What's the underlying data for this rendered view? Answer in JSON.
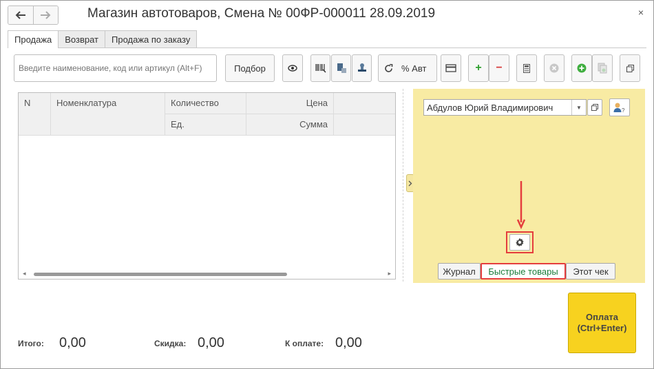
{
  "window": {
    "title": "Магазин автотоваров, Смена № 00ФР-000011  28.09.2019",
    "close_glyph": "×",
    "back_glyph": "🡐",
    "forward_glyph": "🡒"
  },
  "tabs": [
    {
      "label": "Продажа",
      "active": true
    },
    {
      "label": "Возврат",
      "active": false
    },
    {
      "label": "Продажа по заказу",
      "active": false
    }
  ],
  "toolbar": {
    "search_placeholder": "Введите наименование, код или артикул (Alt+F)",
    "podbor_label": "Подбор",
    "auto_discount_label": "% Авт",
    "plus_glyph": "+",
    "minus_glyph": "−"
  },
  "grid": {
    "columns": {
      "n": "N",
      "nomenclature": "Номенклатура",
      "quantity": "Количество",
      "price": "Цена",
      "unit": "Ед.",
      "sum": "Сумма"
    },
    "rows": []
  },
  "panel": {
    "cashier_name": "Абдулов Юрий Владимирович",
    "tabs": [
      {
        "label": "Журнал",
        "active": false
      },
      {
        "label": "Быстрые товары",
        "active": true
      },
      {
        "label": "Этот чек",
        "active": false
      }
    ]
  },
  "footer": {
    "total_label": "Итого:",
    "total_value": "0,00",
    "discount_label": "Скидка:",
    "discount_value": "0,00",
    "to_pay_label": "К оплате:",
    "to_pay_value": "0,00",
    "pay_line1": "Оплата",
    "pay_line2": "(Ctrl+Enter)"
  },
  "colors": {
    "panel_bg": "#f8eba3",
    "pay_button": "#f7d21f",
    "highlight": "#e53d3d",
    "active_tab_text": "#1a7d3a",
    "plus_green": "#2e9e2e",
    "minus_red": "#d83b3b"
  }
}
